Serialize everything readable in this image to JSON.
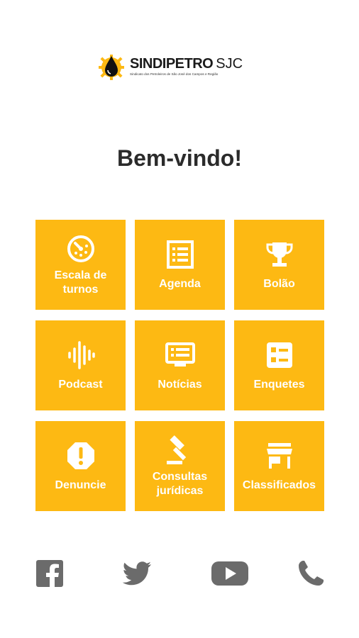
{
  "brand": {
    "name_bold": "SINDIPETRO",
    "name_light": "SJC",
    "tagline": "Sindicato dos Petroleiros de São José dos Campos e Região",
    "colors": {
      "accent": "#fdb913",
      "text": "#2b2b2b",
      "icon_gray": "#6b6b6b"
    }
  },
  "welcome": {
    "title": "Bem-vindo!"
  },
  "menu": {
    "tiles": [
      {
        "label": "Escala de turnos",
        "icon": "clock-icon"
      },
      {
        "label": "Agenda",
        "icon": "list-icon"
      },
      {
        "label": "Bolão",
        "icon": "trophy-icon"
      },
      {
        "label": "Podcast",
        "icon": "audio-wave-icon"
      },
      {
        "label": "Notícias",
        "icon": "news-monitor-icon"
      },
      {
        "label": "Enquetes",
        "icon": "poll-icon"
      },
      {
        "label": "Denuncie",
        "icon": "alert-icon"
      },
      {
        "label": "Consultas jurídicas",
        "icon": "gavel-icon"
      },
      {
        "label": "Classificados",
        "icon": "store-icon"
      }
    ]
  },
  "social": {
    "items": [
      {
        "icon": "facebook-icon"
      },
      {
        "icon": "twitter-icon"
      },
      {
        "icon": "youtube-icon"
      },
      {
        "icon": "phone-icon"
      }
    ]
  }
}
